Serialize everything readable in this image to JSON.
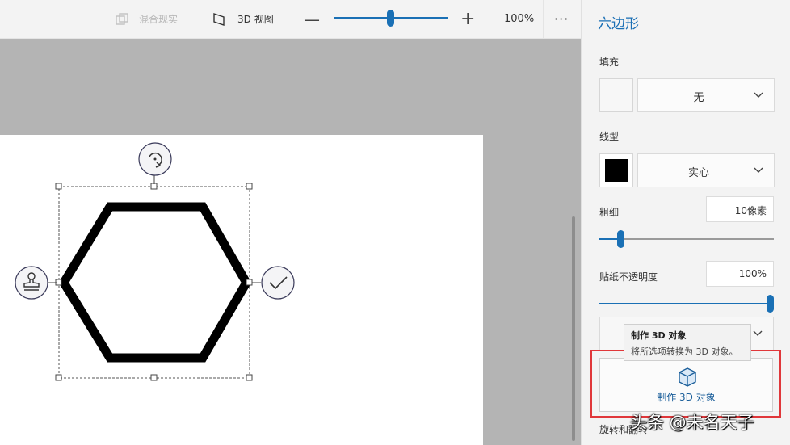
{
  "toolbar": {
    "mixed_reality": "混合现实",
    "view_3d": "3D 视图",
    "zoom_pct": "100%",
    "zoom_level": 0.5,
    "more": "···"
  },
  "panel": {
    "title": "六边形",
    "fill": {
      "label": "填充",
      "value": "无"
    },
    "line_type": {
      "label": "线型",
      "value": "实心"
    },
    "thickness": {
      "label": "粗细",
      "value": "10像素",
      "level": 0.12
    },
    "sticker_opacity": {
      "label": "贴纸不透明度",
      "value": "100%",
      "level": 1.0
    },
    "tooltip": {
      "title": "制作 3D 对象",
      "desc": "将所选项转换为 3D 对象。"
    },
    "make3d_label": "制作 3D 对象",
    "next_section": "旋转和翻转"
  },
  "colors": {
    "accent": "#1a70b5",
    "highlight": "#e0373a",
    "stroke": "#000000"
  },
  "icons": [
    "mixed-reality-icon",
    "view-3d-icon",
    "rotate-icon",
    "stamp-icon",
    "check-icon",
    "cube-icon",
    "chevron-down-icon"
  ],
  "watermark": "头条 @未名天子"
}
